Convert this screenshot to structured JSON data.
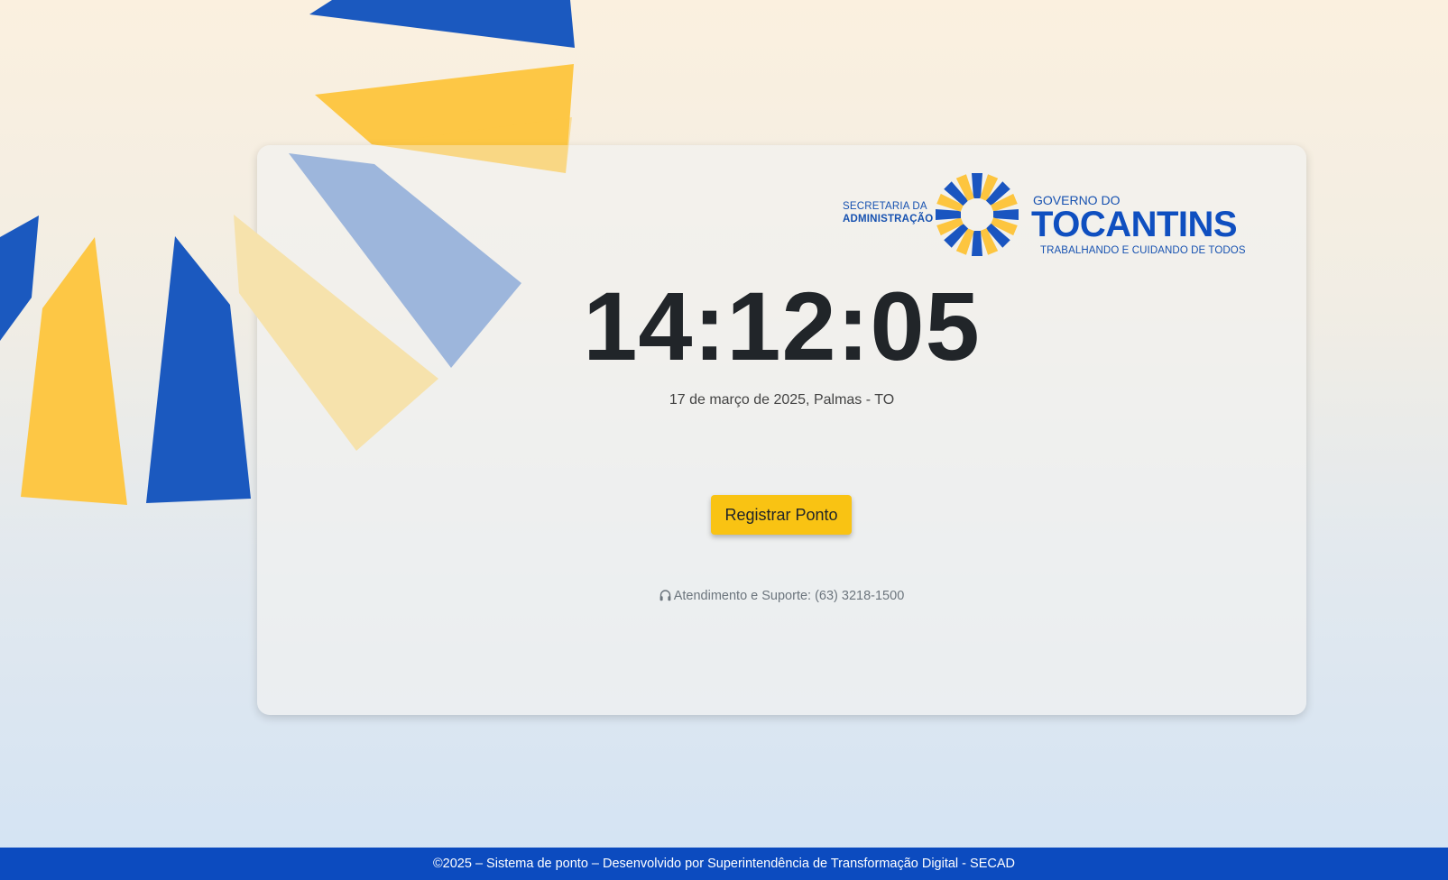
{
  "logo": {
    "secretaria_line1": "SECRETARIA DA",
    "secretaria_line2": "ADMINISTRAÇÃO",
    "governo": "GOVERNO DO",
    "state": "TOCANTINS",
    "slogan": "TRABALHANDO E CUIDANDO DE TODOS"
  },
  "clock": {
    "time": "14:12:05",
    "date_location": "17 de março de 2025, Palmas - TO"
  },
  "actions": {
    "register_label": "Registrar Ponto"
  },
  "support": {
    "icon": "headset-icon",
    "text": "Atendimento e Suporte: (63) 3218-1500"
  },
  "footer": {
    "text": "©2025 – Sistema de ponto – Desenvolvido por Superintendência de Transformação Digital - SECAD"
  },
  "colors": {
    "blue": "#1a56bd",
    "yellow": "#fdc53f",
    "footer_bg": "#0c4bbf",
    "button_bg": "#f9c313"
  }
}
